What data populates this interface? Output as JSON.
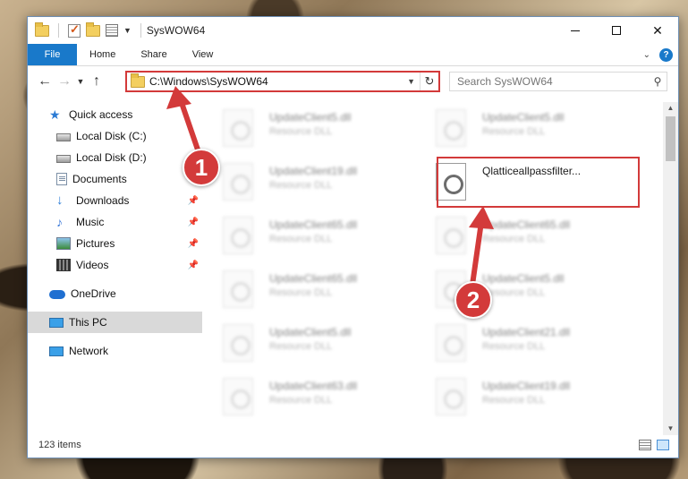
{
  "window": {
    "title": "SysWOW64"
  },
  "ribbon": {
    "tabs": [
      "File",
      "Home",
      "Share",
      "View"
    ]
  },
  "address": {
    "path": "C:\\Windows\\SysWOW64"
  },
  "search": {
    "placeholder": "Search SysWOW64"
  },
  "nav": {
    "items": [
      {
        "label": "Quick access"
      },
      {
        "label": "Local Disk (C:)"
      },
      {
        "label": "Local Disk (D:)"
      },
      {
        "label": "Documents"
      },
      {
        "label": "Downloads"
      },
      {
        "label": "Music"
      },
      {
        "label": "Pictures"
      },
      {
        "label": "Videos"
      },
      {
        "label": "OneDrive"
      },
      {
        "label": "This PC"
      },
      {
        "label": "Network"
      }
    ]
  },
  "files": {
    "left": [
      {
        "name": "UpdateClient5.dll",
        "type": "Resource DLL"
      },
      {
        "name": "UpdateClient19.dll",
        "type": "Resource DLL"
      },
      {
        "name": "UpdateClient65.dll",
        "type": "Resource DLL"
      },
      {
        "name": "UpdateClient65.dll",
        "type": "Resource DLL"
      },
      {
        "name": "UpdateClient5.dll",
        "type": "Resource DLL"
      },
      {
        "name": "UpdateClient63.dll",
        "type": "Resource DLL"
      }
    ],
    "right": [
      {
        "name": "UpdateClient5.dll",
        "type": "Resource DLL"
      },
      {
        "name": "Qlatticeallpassfilter...",
        "type": ""
      },
      {
        "name": "UpdateClient65.dll",
        "type": "Resource DLL"
      },
      {
        "name": "UpdateClient5.dll",
        "type": "Resource DLL"
      },
      {
        "name": "UpdateClient21.dll",
        "type": "Resource DLL"
      },
      {
        "name": "UpdateClient19.dll",
        "type": "Resource DLL"
      }
    ]
  },
  "status": {
    "count": "123 items"
  },
  "annotations": {
    "step1": "1",
    "step2": "2",
    "color": "#d33a3a"
  }
}
